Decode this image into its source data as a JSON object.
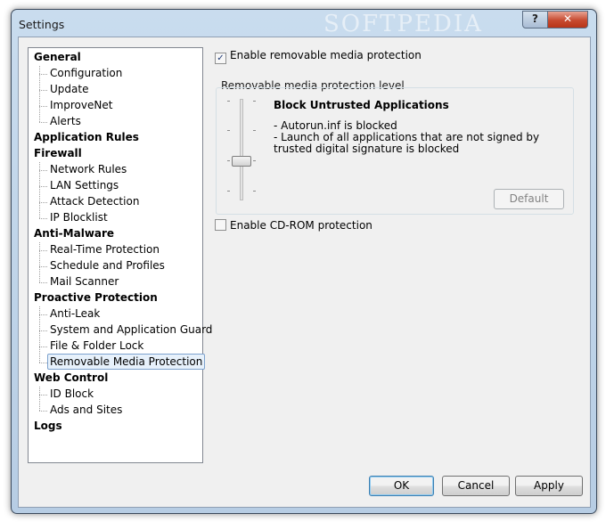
{
  "window": {
    "title": "Settings",
    "watermark": "SOFTPEDIA",
    "help_label": "?",
    "close_label": "✕"
  },
  "tree": {
    "general": "General",
    "configuration": "Configuration",
    "update": "Update",
    "improvenet": "ImproveNet",
    "alerts": "Alerts",
    "application_rules": "Application Rules",
    "firewall": "Firewall",
    "network_rules": "Network Rules",
    "lan_settings": "LAN Settings",
    "attack_detection": "Attack Detection",
    "ip_blocklist": "IP Blocklist",
    "anti_malware": "Anti-Malware",
    "real_time": "Real-Time Protection",
    "schedule": "Schedule and Profiles",
    "mail_scanner": "Mail Scanner",
    "proactive": "Proactive Protection",
    "anti_leak": "Anti-Leak",
    "system_guard": "System and Application Guard",
    "file_lock": "File & Folder Lock",
    "removable_media": "Removable Media Protection",
    "web_control": "Web Control",
    "id_block": "ID Block",
    "ads_sites": "Ads and Sites",
    "logs": "Logs"
  },
  "main": {
    "enable_removable": {
      "label": "Enable removable media protection",
      "checked": true,
      "check_glyph": "✓"
    },
    "level_group_label": "Removable media protection level",
    "level_title": "Block Untrusted Applications",
    "level_desc_1": "- Autorun.inf is blocked",
    "level_desc_2": "- Launch of all applications that are not signed by trusted digital signature is blocked",
    "default_button": "Default",
    "enable_cdrom": {
      "label": "Enable CD-ROM protection",
      "checked": false
    }
  },
  "footer": {
    "ok": "OK",
    "cancel": "Cancel",
    "apply": "Apply"
  }
}
